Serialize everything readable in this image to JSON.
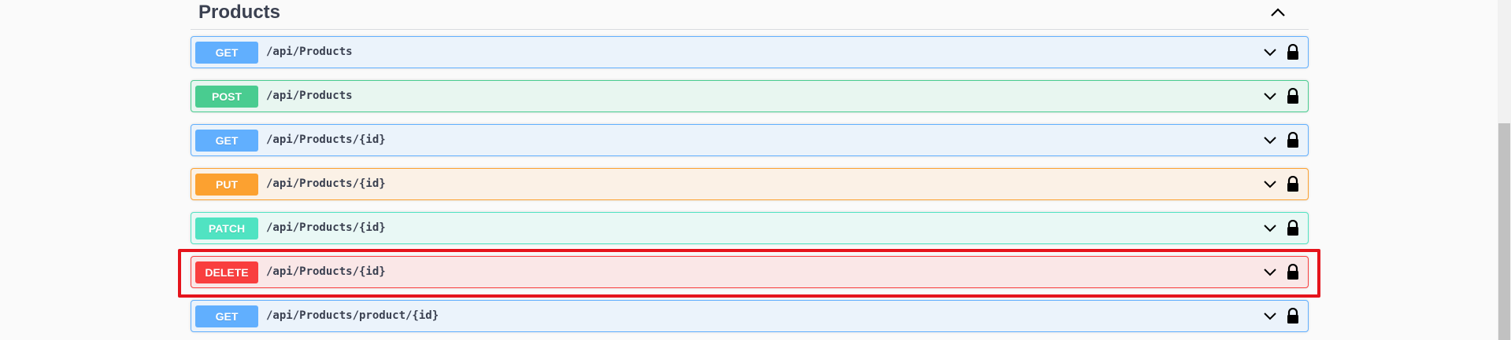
{
  "section": {
    "title": "Products"
  },
  "operations": [
    {
      "method": "GET",
      "path": "/api/Products"
    },
    {
      "method": "POST",
      "path": "/api/Products"
    },
    {
      "method": "GET",
      "path": "/api/Products/{id}"
    },
    {
      "method": "PUT",
      "path": "/api/Products/{id}"
    },
    {
      "method": "PATCH",
      "path": "/api/Products/{id}"
    },
    {
      "method": "DELETE",
      "path": "/api/Products/{id}"
    },
    {
      "method": "GET",
      "path": "/api/Products/product/{id}"
    }
  ],
  "colors": {
    "get": "#61affe",
    "post": "#49cc90",
    "put": "#fca130",
    "patch": "#50e3c2",
    "delete": "#f93e3e",
    "highlight": "#e5141c"
  },
  "icons": {
    "collapse": "chevron-up-icon",
    "expand": "chevron-down-icon",
    "auth": "lock-icon"
  }
}
